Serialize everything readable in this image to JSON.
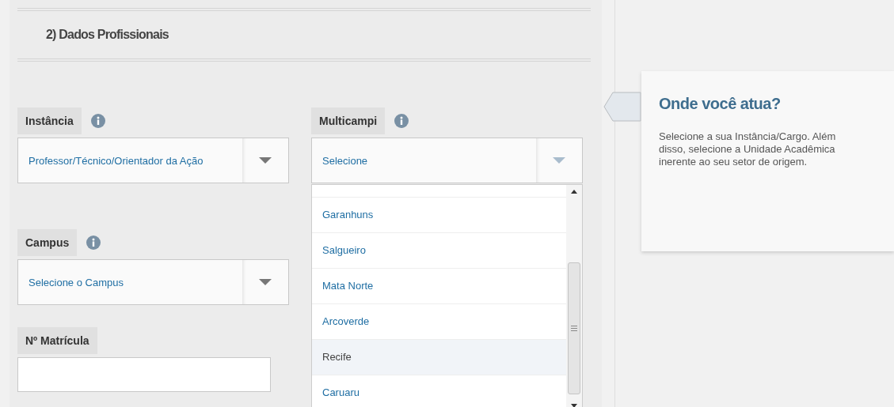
{
  "section": {
    "title": "2) Dados Profissionais"
  },
  "fields": [
    {
      "kind": "select",
      "label": "Instância",
      "info": true,
      "value": "Professor/Técnico/Orientador da Ação",
      "expanded": false
    },
    {
      "kind": "select",
      "label": "Multicampi",
      "info": true,
      "value": "Selecione",
      "expanded": true,
      "options": [
        {
          "label": "Garanhuns",
          "selected": false
        },
        {
          "label": "Salgueiro",
          "selected": false
        },
        {
          "label": "Mata Norte",
          "selected": false
        },
        {
          "label": "Arcoverde",
          "selected": false
        },
        {
          "label": "Recife",
          "selected": true
        },
        {
          "label": "Caruaru",
          "selected": false
        }
      ]
    },
    {
      "kind": "select",
      "label": "Campus",
      "info": true,
      "value": "Selecione o Campus",
      "expanded": false
    },
    {
      "kind": "text",
      "label": "Nº Matrícula",
      "info": false
    }
  ],
  "help": {
    "title": "Onde você atua?",
    "text": "Selecione a sua Instância/Cargo. Além disso, selecione a Unidade Acadêmica inerente ao seu setor de origem."
  }
}
